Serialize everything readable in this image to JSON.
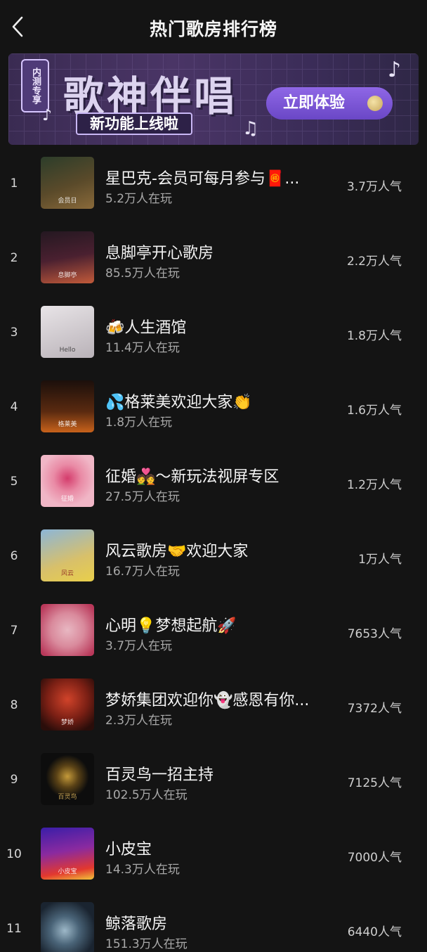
{
  "header": {
    "title": "热门歌房排行榜",
    "back_icon": "chevron-left-icon"
  },
  "banner": {
    "tag": "内测专享",
    "headline": "歌神伴唱",
    "subline": "新功能上线啦",
    "cta_label": "立即体验",
    "accent": "#7b55d6"
  },
  "rooms": [
    {
      "rank": "1",
      "name": "星巴克-会员可每月参与🧧...",
      "players": "5.2万人在玩",
      "popularity": "3.7万人气",
      "thumb_colors": [
        "#2c3d2a",
        "#8a6a3a"
      ]
    },
    {
      "rank": "2",
      "name": "息脚亭开心歌房",
      "players": "85.5万人在玩",
      "popularity": "2.2万人气",
      "thumb_colors": [
        "#241821",
        "#c25a3a"
      ]
    },
    {
      "rank": "3",
      "name": "🍻人生酒馆",
      "players": "11.4万人在玩",
      "popularity": "1.8万人气",
      "thumb_colors": [
        "#e4e0e3",
        "#b9b2b8"
      ]
    },
    {
      "rank": "4",
      "name": "💦格莱美欢迎大家👏",
      "players": "1.8万人在玩",
      "popularity": "1.6万人气",
      "thumb_colors": [
        "#1b0f0b",
        "#c8621b"
      ]
    },
    {
      "rank": "5",
      "name": "征婚💑～新玩法视屏专区",
      "players": "27.5万人在玩",
      "popularity": "1.2万人气",
      "thumb_colors": [
        "#f0b6c6",
        "#d43c6c"
      ]
    },
    {
      "rank": "6",
      "name": "风云歌房🤝欢迎大家",
      "players": "16.7万人在玩",
      "popularity": "1万人气",
      "thumb_colors": [
        "#8cb6d8",
        "#e9cf4a"
      ]
    },
    {
      "rank": "7",
      "name": "心明💡梦想起航🚀",
      "players": "3.7万人在玩",
      "popularity": "7653人气",
      "thumb_colors": [
        "#e8b7c2",
        "#b9385a"
      ]
    },
    {
      "rank": "8",
      "name": "梦娇集团欢迎你👻感恩有你...",
      "players": "2.3万人在玩",
      "popularity": "7372人气",
      "thumb_colors": [
        "#2a0d0a",
        "#d1432a"
      ]
    },
    {
      "rank": "9",
      "name": "百灵鸟一招主持",
      "players": "102.5万人在玩",
      "popularity": "7125人气",
      "thumb_colors": [
        "#0d0d0d",
        "#c49a3a"
      ]
    },
    {
      "rank": "10",
      "name": "小皮宝",
      "players": "14.3万人在玩",
      "popularity": "7000人气",
      "thumb_colors": [
        "#3a1ea8",
        "#e3382e"
      ]
    },
    {
      "rank": "11",
      "name": "鲸落歌房",
      "players": "151.3万人在玩",
      "popularity": "6440人气",
      "thumb_colors": [
        "#1a2430",
        "#9db8c8"
      ]
    }
  ],
  "thumb_text": {
    "r1": "会员日",
    "r2": "息脚亭",
    "r3": "Hello",
    "r4": "格莱美",
    "r5": "征婚",
    "r6": "风云",
    "r8": "梦娇",
    "r9": "百灵鸟",
    "r10": "小皮宝"
  }
}
